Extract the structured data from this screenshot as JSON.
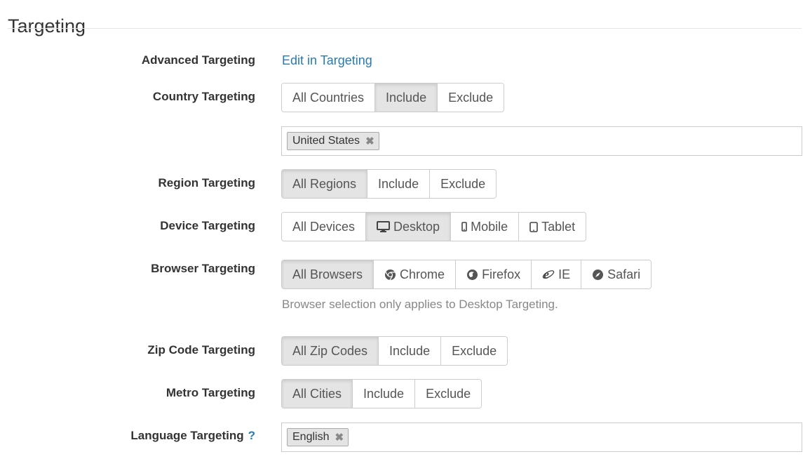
{
  "page": {
    "title": "Targeting"
  },
  "advanced": {
    "label": "Advanced Targeting",
    "link": "Edit in Targeting"
  },
  "country": {
    "label": "Country Targeting",
    "options": [
      "All Countries",
      "Include",
      "Exclude"
    ],
    "selected": "Include",
    "tags": [
      "United States"
    ]
  },
  "region": {
    "label": "Region Targeting",
    "options": [
      "All Regions",
      "Include",
      "Exclude"
    ],
    "selected": "All Regions"
  },
  "device": {
    "label": "Device Targeting",
    "options": [
      "All Devices",
      "Desktop",
      "Mobile",
      "Tablet"
    ],
    "icons": [
      "",
      "desktop-icon",
      "mobile-icon",
      "tablet-icon"
    ],
    "selected": "Desktop"
  },
  "browser": {
    "label": "Browser Targeting",
    "options": [
      "All Browsers",
      "Chrome",
      "Firefox",
      "IE",
      "Safari"
    ],
    "icons": [
      "",
      "chrome-icon",
      "firefox-icon",
      "ie-icon",
      "safari-icon"
    ],
    "selected": "All Browsers",
    "help": "Browser selection only applies to Desktop Targeting."
  },
  "zip": {
    "label": "Zip Code Targeting",
    "options": [
      "All Zip Codes",
      "Include",
      "Exclude"
    ],
    "selected": "All Zip Codes"
  },
  "metro": {
    "label": "Metro Targeting",
    "options": [
      "All Cities",
      "Include",
      "Exclude"
    ],
    "selected": "All Cities"
  },
  "language": {
    "label": "Language Targeting",
    "help_icon": "?",
    "tags": [
      "English"
    ]
  },
  "colors": {
    "link": "#2a7ab0",
    "active_bg": "#e4e4e4",
    "border": "#cccccc",
    "muted": "#888888"
  }
}
